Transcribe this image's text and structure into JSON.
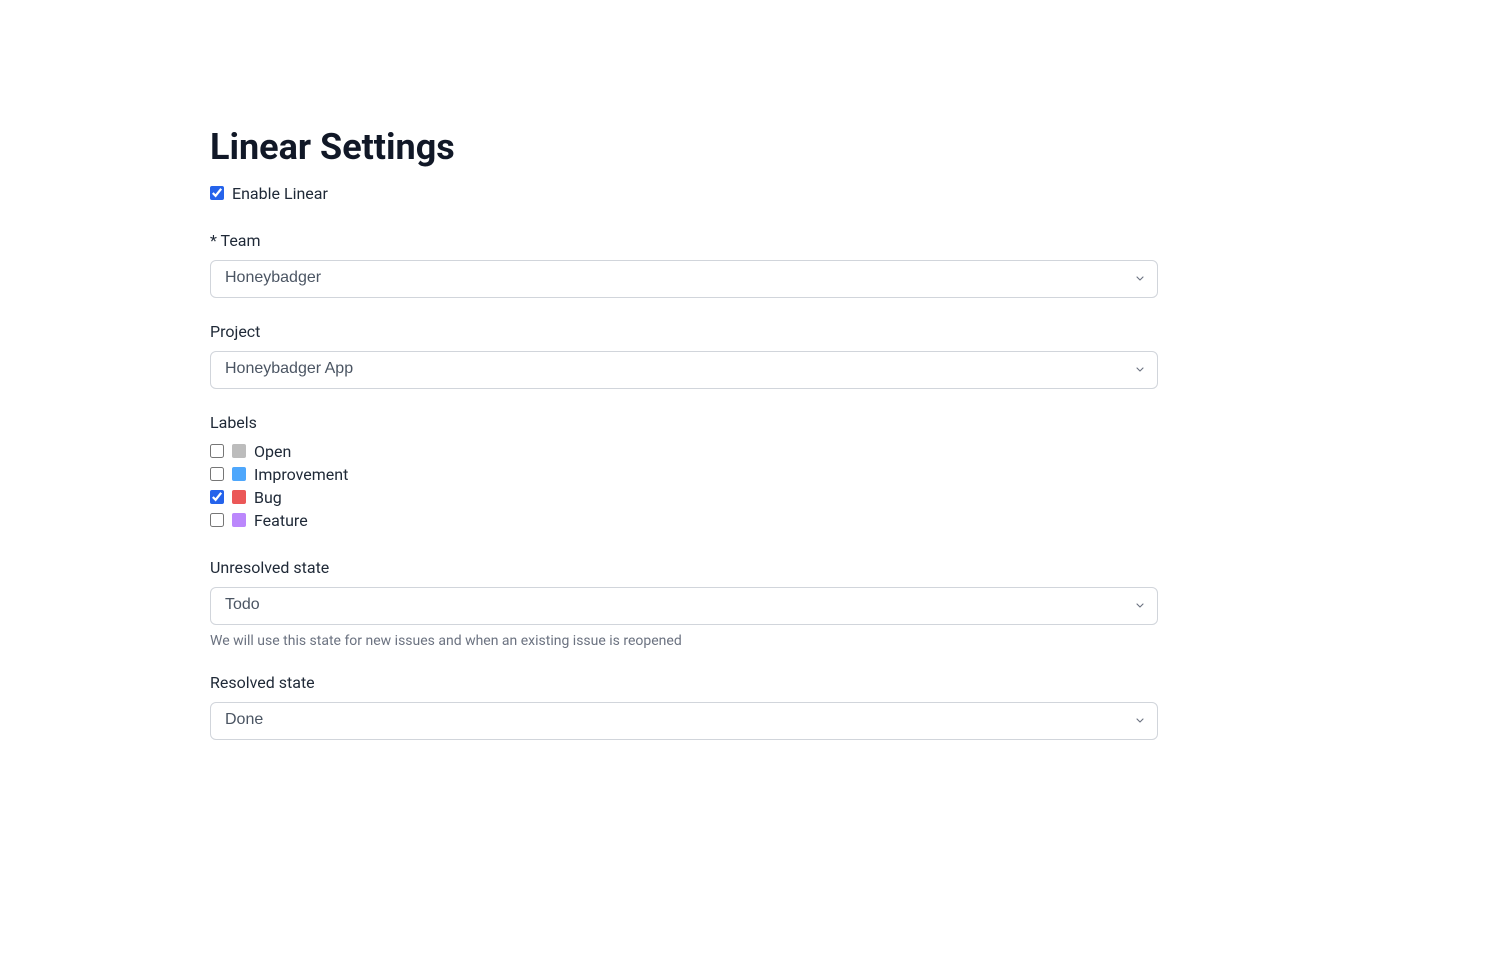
{
  "title": "Linear Settings",
  "enable": {
    "label": "Enable Linear",
    "checked": true
  },
  "team": {
    "label": "* Team",
    "value": "Honeybadger"
  },
  "project": {
    "label": "Project",
    "value": "Honeybadger App"
  },
  "labels": {
    "title": "Labels",
    "items": [
      {
        "name": "Open",
        "color": "#bcbcbc",
        "checked": false
      },
      {
        "name": "Improvement",
        "color": "#4ea7fc",
        "checked": false
      },
      {
        "name": "Bug",
        "color": "#eb5757",
        "checked": true
      },
      {
        "name": "Feature",
        "color": "#bb87fc",
        "checked": false
      }
    ]
  },
  "unresolved": {
    "label": "Unresolved state",
    "value": "Todo",
    "help": "We will use this state for new issues and when an existing issue is reopened"
  },
  "resolved": {
    "label": "Resolved state",
    "value": "Done"
  }
}
